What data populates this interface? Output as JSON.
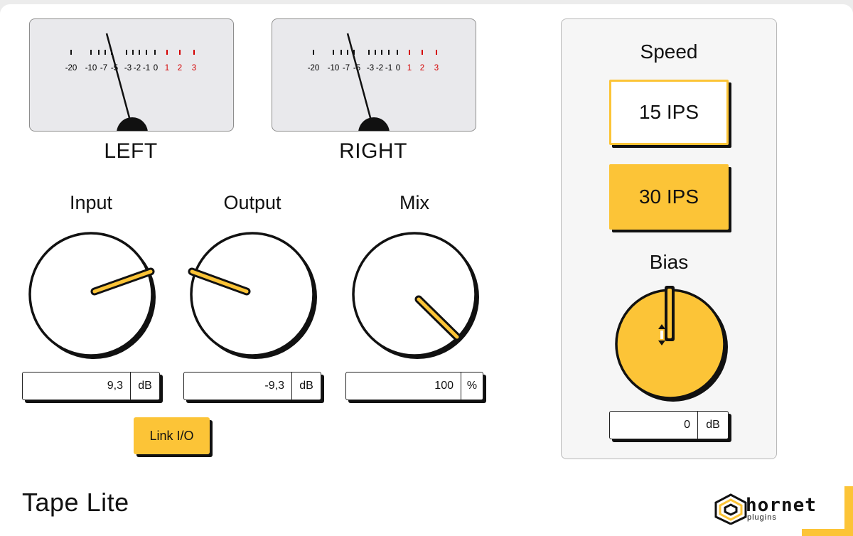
{
  "app": {
    "title": "Tape Lite"
  },
  "meters": [
    {
      "label": "LEFT",
      "scale": [
        "-20",
        "-10",
        "-7",
        "-5",
        "-3",
        "-2",
        "-1",
        "0",
        "1",
        "2",
        "3"
      ]
    },
    {
      "label": "RIGHT",
      "scale": [
        "-20",
        "-10",
        "-7",
        "-5",
        "-3",
        "-2",
        "-1",
        "0",
        "1",
        "2",
        "3"
      ]
    }
  ],
  "knobs": {
    "input": {
      "label": "Input",
      "value": "9,3",
      "unit": "dB"
    },
    "output": {
      "label": "Output",
      "value": "-9,3",
      "unit": "dB"
    },
    "mix": {
      "label": "Mix",
      "value": "100",
      "unit": "%"
    }
  },
  "link_button": {
    "label": "Link I/O"
  },
  "speed": {
    "title": "Speed",
    "options": [
      {
        "label": "15 IPS",
        "selected": false
      },
      {
        "label": "30 IPS",
        "selected": true
      }
    ]
  },
  "bias": {
    "label": "Bias",
    "value": "0",
    "unit": "dB"
  },
  "logo": {
    "name": "hornet",
    "subtitle": "plugins"
  },
  "colors": {
    "accent": "#fcc437",
    "ink": "#111111",
    "meter_bg": "#e9e9ec",
    "peak": "#d40000"
  }
}
